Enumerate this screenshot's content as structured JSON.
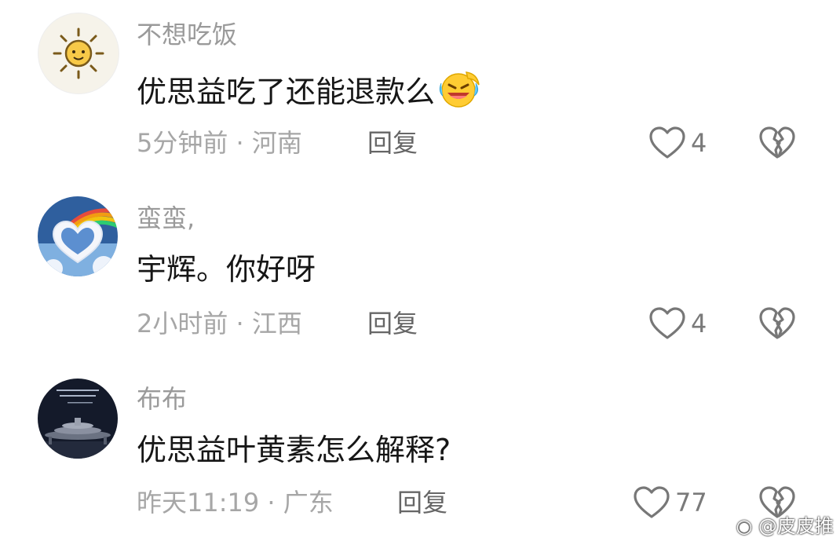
{
  "comments": [
    {
      "username": "不想吃饭",
      "content": "优思益吃了还能退款么",
      "emoji": "laughing-tears-emoji",
      "time": "5分钟前",
      "location": "河南",
      "separator": "·",
      "reply_label": "回复",
      "likes": "4",
      "avatar": "sun-doodle"
    },
    {
      "username": "蛮蛮,",
      "content": "宇辉。你好呀",
      "time": "2小时前",
      "location": "江西",
      "separator": "·",
      "reply_label": "回复",
      "likes": "4",
      "avatar": "rainbow-heart-cloud"
    },
    {
      "username": "布布",
      "content": "优思益叶黄素怎么解释?",
      "time": "昨天11:19",
      "location": "广东",
      "separator": "·",
      "reply_label": "回复",
      "likes": "77",
      "avatar": "night-tower"
    }
  ],
  "watermark": "@皮皮推",
  "icons": {
    "like": "heart-outline-icon",
    "dislike": "broken-heart-icon"
  },
  "colors": {
    "username": "#9a9a9a",
    "content": "#161616",
    "meta": "#a6a6a6",
    "reply": "#666666",
    "icon": "#777777"
  }
}
